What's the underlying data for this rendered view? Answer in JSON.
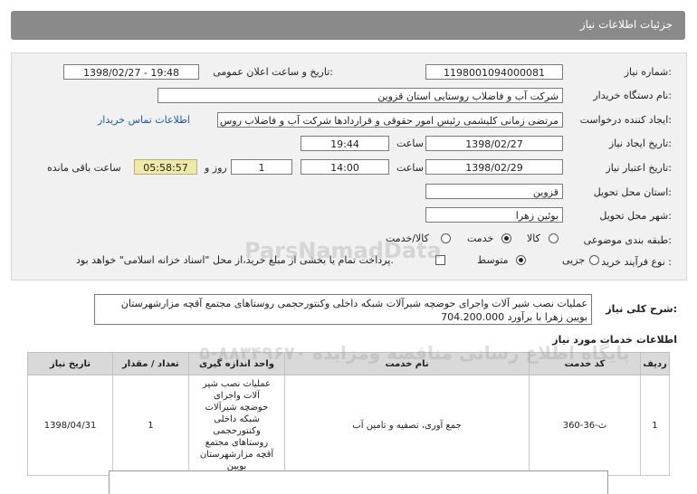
{
  "header": {
    "title": "جزئیات اطلاعات نیاز"
  },
  "form": {
    "need_number_label": "شماره نیاز:",
    "need_number": "1198001094000081",
    "announce_label": "تاریخ و ساعت اعلان عمومی:",
    "announce_value": "1398/02/27 - 19:48",
    "buyer_label": "نام دستگاه خریدار:",
    "buyer_value": "شرکت آب و فاضلاب روستایی استان قزوین",
    "creator_label": "ایجاد کننده درخواست:",
    "creator_value": "مرتضی زمانی کلیشمی رئیس امور حقوقی و قراردادها شرکت آب و فاضلاب روس",
    "contact_link": "اطلاعات تماس خریدار",
    "created_date_label": "تاریخ ایجاد نیاز:",
    "created_date": "1398/02/27",
    "time_label": "ساعت",
    "created_time": "19:44",
    "valid_date_label": "تاریخ اعتبار نیاز:",
    "valid_date": "1398/02/29",
    "valid_time": "14:00",
    "days_value": "1",
    "days_label": "روز و",
    "remaining_time": "05:58:57",
    "remaining_label": "ساعت باقی مانده",
    "province_label": "استان محل تحویل:",
    "province_value": "قزوین",
    "city_label": "شهر محل تحویل:",
    "city_value": "بوئین زهرا",
    "category_label": "طبقه بندی موضوعی:",
    "category_options": [
      "کالا",
      "خدمت",
      "کالا/خدمت"
    ],
    "category_selected": "خدمت",
    "process_label": "نوع فرآیند خرید :",
    "process_options": [
      "جزیی",
      "متوسط"
    ],
    "process_selected": "متوسط",
    "payment_note": "پرداخت تمام یا بخشی از مبلغ خرید،از محل \"اسناد خزانه اسلامی\" خواهد بود."
  },
  "description": {
    "label": "شرح کلی نیاز:",
    "text": "عملیات نصب شیر آلات واجرای حوضچه شیرآلات شبکه داخلی وکنتورحجمی روستاهای مجتمع آقچه مزارشهرستان بویین زهرا  با برآورد 704.200.000"
  },
  "services": {
    "title": "اطلاعات خدمات مورد نیاز",
    "watermark": "پایگاه اطلاع رسانی مناقصه ومزایده ۸۸۳۴۹۶۷۰-۵",
    "columns": [
      "ردیف",
      "کد خدمت",
      "نام خدمت",
      "واحد اندازه گیری",
      "تعداد / مقدار",
      "تاریخ نیاز"
    ],
    "rows": [
      {
        "row": "1",
        "code": "ث-36-360",
        "name": "جمع آوری، تصفیه و تامین آب",
        "unit": "عملیات نصب شیر آلات واجرای حوضچه شیرآلات شبکه داخلی وکنتورحجمی روستاهای مجتمع آقچه مزارشهرستان بویین",
        "qty": "1",
        "date": "1398/04/31"
      }
    ]
  },
  "watermark_logo": "ParsNamadData"
}
